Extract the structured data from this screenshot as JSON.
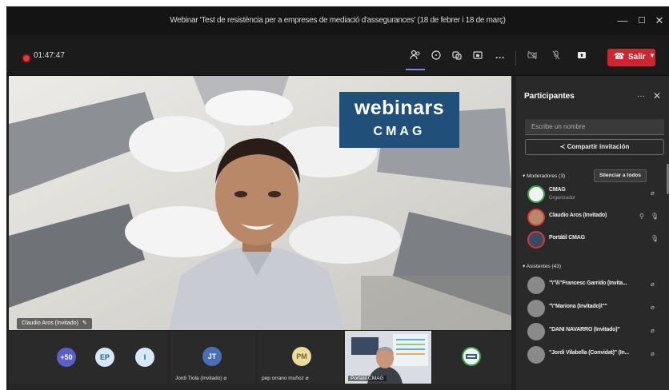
{
  "window": {
    "title": "Webinar 'Test de resistència per a empreses de mediació d'assegurances' (18 de febrer i 18 de març)",
    "minimize_glyph": "—",
    "maximize_glyph": "☐",
    "close_glyph": "✕"
  },
  "toolbar": {
    "timer": "01:47:47",
    "leave_label": "Salir",
    "icons": [
      "people-icon",
      "chat-icon",
      "reactions-icon",
      "share-screen-icon",
      "more-icon",
      "camera-off-icon",
      "mic-off-icon",
      "share-tray-icon"
    ],
    "leave_color": "#cc2630",
    "accent": "#7b83eb"
  },
  "main_video": {
    "speaker_label": "Claudio Aros (Invitado)",
    "logo_line1": "webinars",
    "logo_line2": "CMAG"
  },
  "strip": {
    "overflow": "+50",
    "bubbles": [
      "EP",
      "I"
    ],
    "tiles": [
      {
        "initials": "JT",
        "name": "Jordi Tiola (Invitado)",
        "color": "#4a6fb5"
      },
      {
        "initials": "PM",
        "name": "pep orrano muñoz",
        "color": "#e8dca0"
      }
    ],
    "video_tile_name": "Portátil CMAG"
  },
  "panel": {
    "title": "Participantes",
    "search_placeholder": "Escribe un nombre",
    "share_label": "Compartir invitación",
    "moderators_label": "Moderadores (3)",
    "mute_all_label": "Silenciar a todos",
    "attendees_label": "Asistentes (43)",
    "moderators": [
      {
        "name": "CMAG",
        "role": "Organizador"
      },
      {
        "name": "Claudio Aros (Invitado)",
        "role": ""
      },
      {
        "name": "Portátil CMAG",
        "role": ""
      }
    ],
    "attendees": [
      {
        "name": "\"\\\"\\\\\\\"Francesc Garrido (Invita..."
      },
      {
        "name": "\"\\\"Mariona (Invitado)\\\"\""
      },
      {
        "name": "\"DANI NAVARRO (Invitado)\""
      },
      {
        "name": "\"Jordi Vilabella (Convidat)\" (In..."
      }
    ]
  }
}
